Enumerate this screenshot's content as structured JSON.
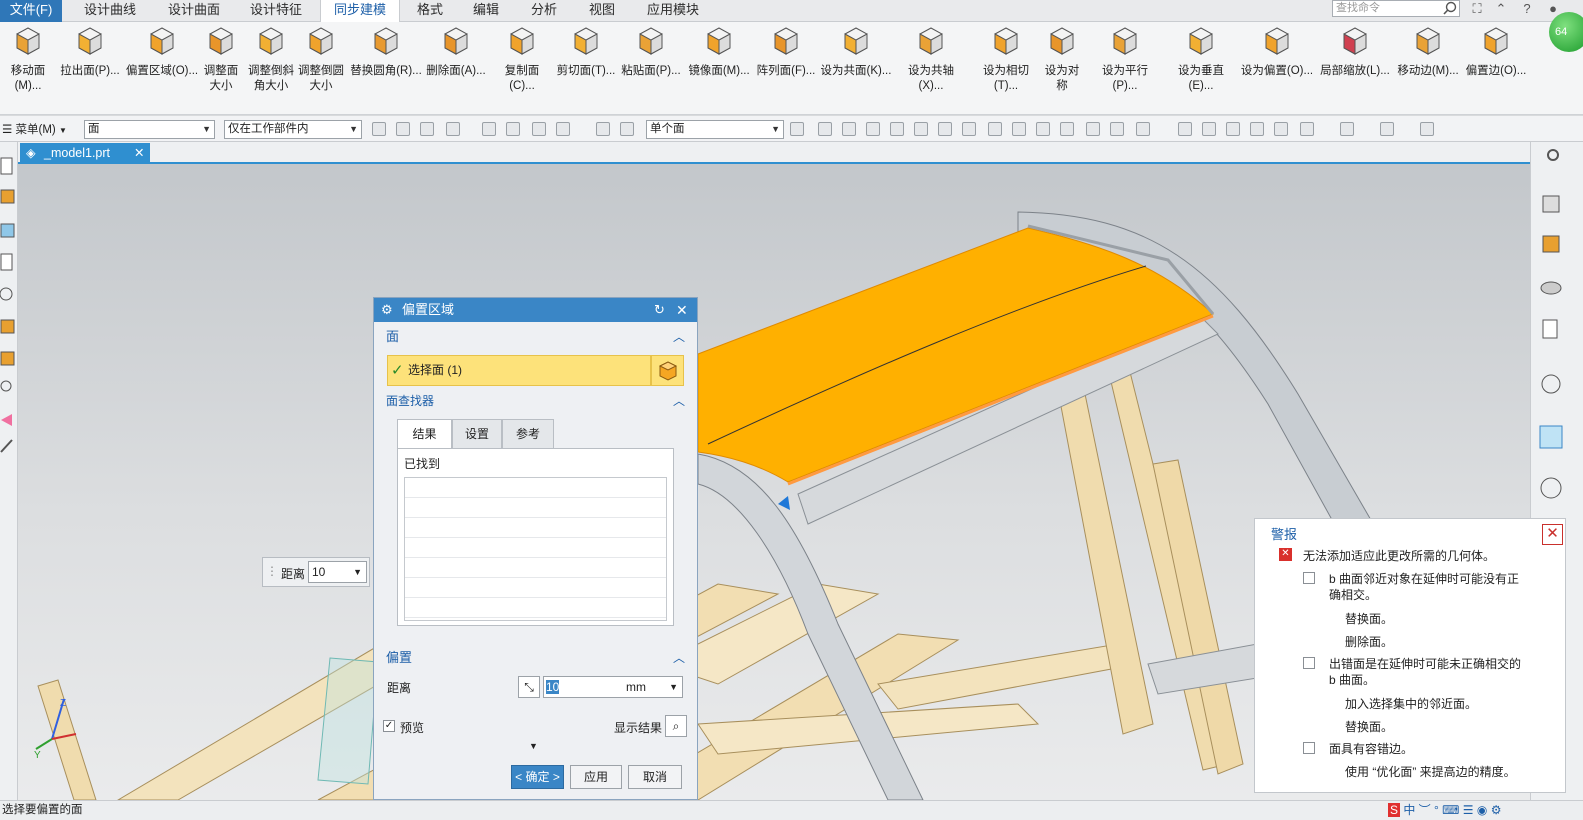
{
  "menu": {
    "file": "文件(F)",
    "items": [
      "设计曲线",
      "设计曲面",
      "设计特征",
      "同步建模",
      "格式",
      "编辑",
      "分析",
      "视图",
      "应用模块"
    ],
    "active_index": 3,
    "search_placeholder": "查找命令"
  },
  "ribbon": {
    "buttons": [
      {
        "label": "移动面(M)..."
      },
      {
        "label": "拉出面(P)..."
      },
      {
        "label": "偏置区域(O)..."
      },
      {
        "label": "调整面\n大小"
      },
      {
        "label": "调整倒斜\n角大小"
      },
      {
        "label": "调整倒圆\n大小"
      },
      {
        "label": "替换圆角(R)..."
      },
      {
        "label": "删除面(A)..."
      },
      {
        "label": "复制面(C)..."
      },
      {
        "label": "剪切面(T)..."
      },
      {
        "label": "粘贴面(P)..."
      },
      {
        "label": "镜像面(M)..."
      },
      {
        "label": "阵列面(F)..."
      },
      {
        "label": "设为共面(K)..."
      },
      {
        "label": "设为共轴(X)..."
      },
      {
        "label": "设为相切(T)..."
      },
      {
        "label": "设为对\n称"
      },
      {
        "label": "设为平行(P)..."
      },
      {
        "label": "设为垂直(E)..."
      },
      {
        "label": "设为偏置(O)..."
      },
      {
        "label": "局部缩放(L)..."
      },
      {
        "label": "移动边(M)..."
      },
      {
        "label": "偏置边(O)..."
      }
    ],
    "badge": "64"
  },
  "selection_bar": {
    "menu_label": "菜单(M)",
    "filter_type": "面",
    "scope": "仅在工作部件内",
    "face_rule": "单个面"
  },
  "document_tab": {
    "name": "_model1.prt"
  },
  "distance_float": {
    "label": "距离",
    "value": "10"
  },
  "dialog": {
    "title": "偏置区域",
    "face_section": "面",
    "select_face": "选择面 (1)",
    "face_finder": "面查找器",
    "tabs": [
      "结果",
      "设置",
      "参考"
    ],
    "found_label": "已找到",
    "offset_section": "偏置",
    "distance_label": "距离",
    "distance_value": "10",
    "unit": "mm",
    "preview_label": "预览",
    "show_result": "显示结果",
    "ok": "< 确定 >",
    "apply": "应用",
    "cancel": "取消"
  },
  "alert": {
    "title": "警报",
    "main_msg": "无法添加适应此更改所需的几何体。",
    "items": [
      {
        "text": "b 曲面邻近对象在延伸时可能没有正确相交。",
        "subs": [
          "替换面。",
          "删除面。"
        ]
      },
      {
        "text": "出错面是在延伸时可能未正确相交的 b 曲面。",
        "subs": [
          "加入选择集中的邻近面。",
          "替换面。"
        ]
      },
      {
        "text": "面具有容错边。",
        "subs": [
          "使用 “优化面” 来提高边的精度。"
        ]
      }
    ]
  },
  "status": {
    "prompt": "选择要偏置的面"
  },
  "colors": {
    "accent": "#2f8fd0",
    "highlight": "#ffb300",
    "alert_red": "#d9302c"
  }
}
